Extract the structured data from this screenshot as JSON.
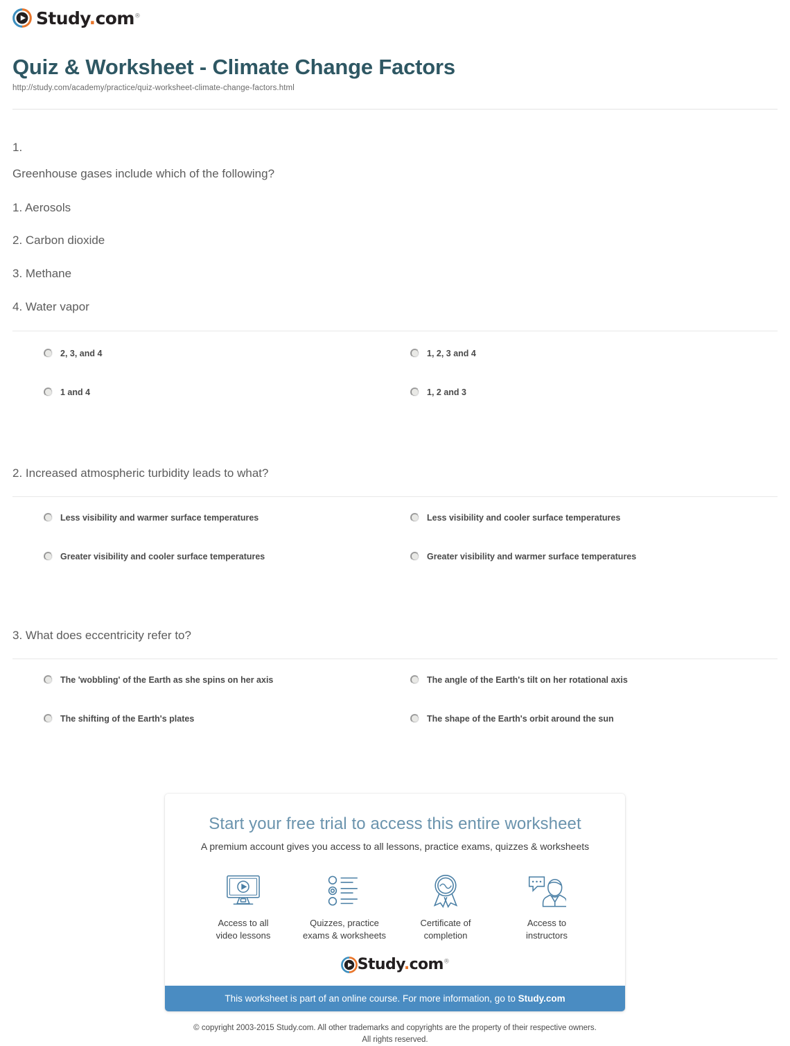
{
  "brand": {
    "name_prefix": "Study",
    "name_dot": ".",
    "name_suffix": "com",
    "trademark": "®",
    "logo_icon": "play-circle-icon",
    "colors": {
      "orange": "#e8762c",
      "blue": "#3d8fbf",
      "dark": "#231f20"
    }
  },
  "header": {
    "title": "Quiz & Worksheet - Climate Change Factors",
    "url": "http://study.com/academy/practice/quiz-worksheet-climate-change-factors.html",
    "title_color": "#2e5763"
  },
  "questions": [
    {
      "number": "1.",
      "prompt": "Greenhouse gases include which of the following?",
      "items": [
        "1. Aerosols",
        "2. Carbon dioxide",
        "3. Methane",
        "4. Water vapor"
      ],
      "options": [
        "2, 3, and 4",
        "1, 2, 3 and 4",
        "1 and 4",
        "1, 2 and 3"
      ]
    },
    {
      "number": "2.",
      "heading": "2. Increased atmospheric turbidity leads to what?",
      "options": [
        "Less visibility and warmer surface temperatures",
        "Less visibility and cooler surface temperatures",
        "Greater visibility and cooler surface temperatures",
        "Greater visibility and warmer surface temperatures"
      ]
    },
    {
      "number": "3.",
      "heading": "3. What does eccentricity refer to?",
      "options": [
        "The 'wobbling' of the Earth as she spins on her axis",
        "The angle of the Earth's tilt on her rotational axis",
        "The shifting of the Earth's plates",
        "The shape of the Earth's orbit around the sun"
      ]
    }
  ],
  "promo": {
    "headline": "Start your free trial to access this entire worksheet",
    "headline_color": "#6a93ad",
    "subtitle": "A premium account gives you access to all lessons, practice exams, quizzes & worksheets",
    "features": [
      {
        "icon": "monitor-play-icon",
        "label": "Access to all\nvideo lessons"
      },
      {
        "icon": "checklist-icon",
        "label": "Quizzes, practice\nexams & worksheets"
      },
      {
        "icon": "award-ribbon-icon",
        "label": "Certificate of\ncompletion"
      },
      {
        "icon": "instructor-chat-icon",
        "label": "Access to\ninstructors"
      }
    ],
    "bar_text": "This worksheet is part of an online course. For more information, go to ",
    "bar_link": "Study.com",
    "bar_color": "#4a8cc2"
  },
  "footer": {
    "line1": "© copyright 2003-2015 Study.com. All other trademarks and copyrights are the property of their respective owners.",
    "line2": "All rights reserved."
  }
}
